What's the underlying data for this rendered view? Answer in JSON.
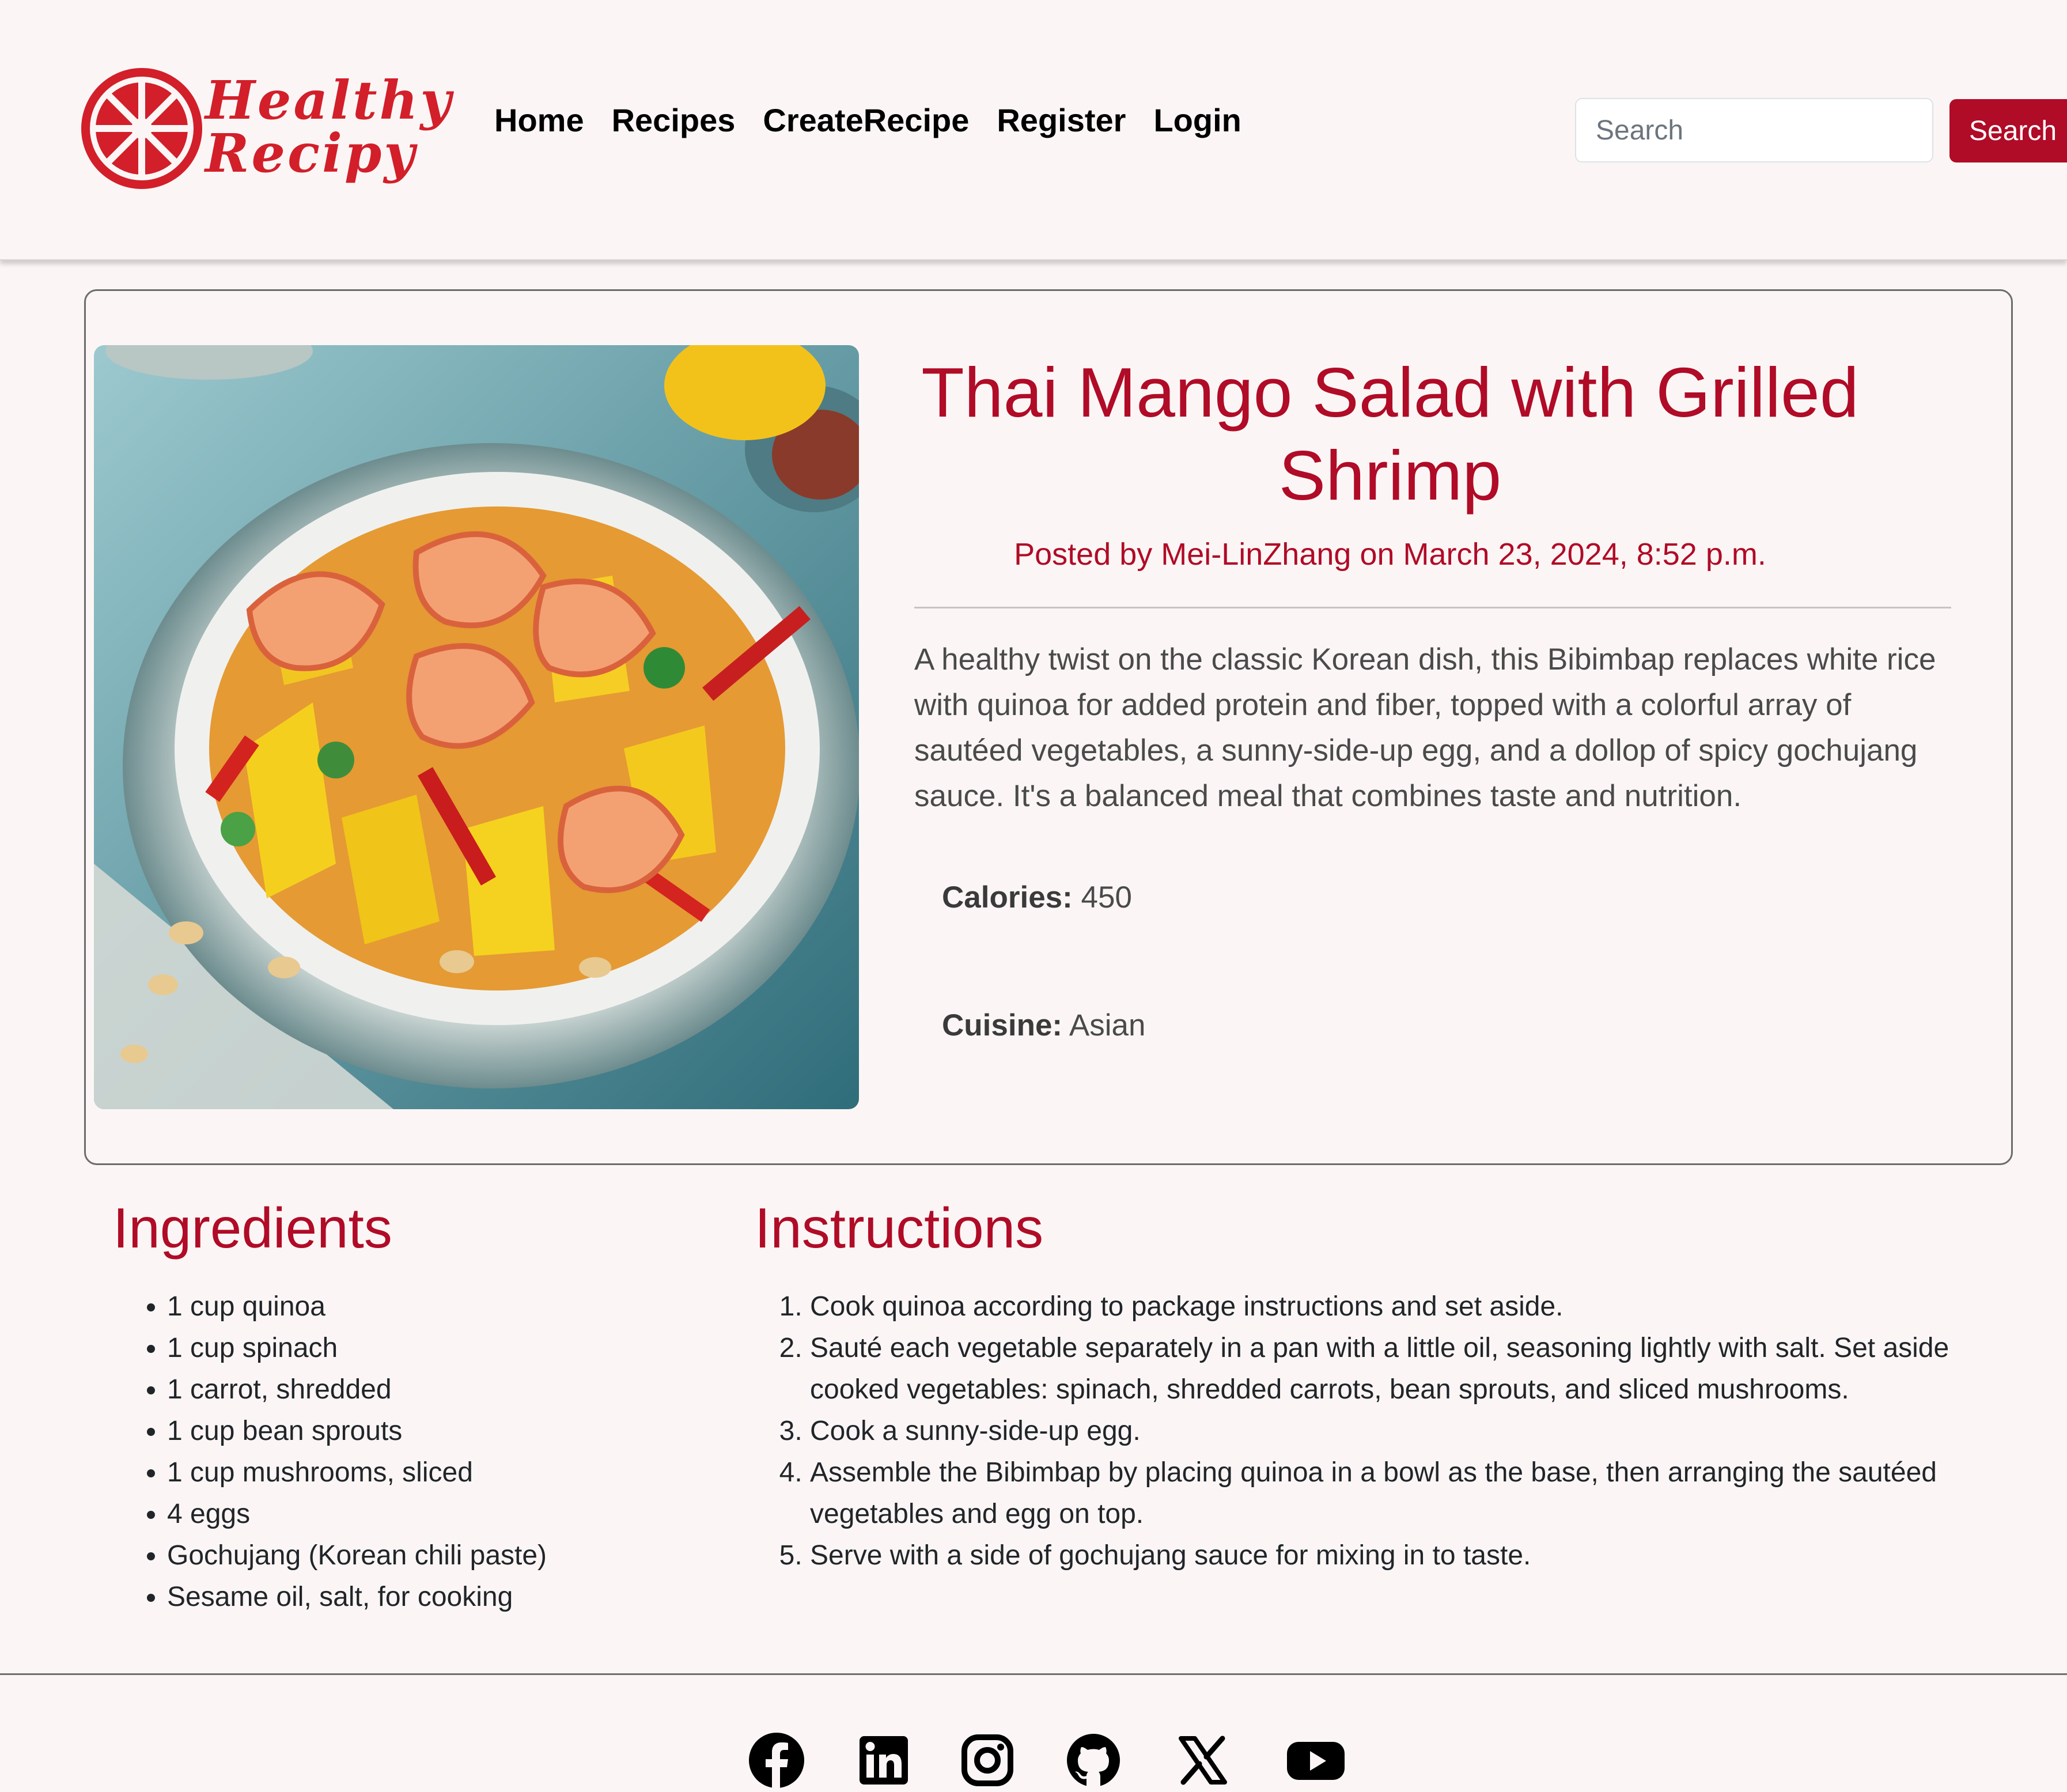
{
  "brand": {
    "line1": "Healthy",
    "line2": "Recipy",
    "accent_color": "#b00b27",
    "logo_color": "#d21f2a"
  },
  "nav": {
    "links": [
      "Home",
      "Recipes",
      "CreateRecipe",
      "Register",
      "Login"
    ]
  },
  "search": {
    "placeholder": "Search",
    "value": "",
    "button_label": "Search"
  },
  "recipe": {
    "title": "Thai Mango Salad with Grilled Shrimp",
    "posted_by": "Posted by Mei-LinZhang on March 23, 2024, 8:52 p.m.",
    "description": "A healthy twist on the classic Korean dish, this Bibimbap replaces white rice with quinoa for added protein and fiber, topped with a colorful array of sautéed vegetables, a sunny-side-up egg, and a dollop of spicy gochujang sauce. It's a balanced meal that combines taste and nutrition.",
    "calories_label": "Calories:",
    "calories_value": "450",
    "cuisine_label": "Cuisine:",
    "cuisine_value": "Asian"
  },
  "ingredients": {
    "heading": "Ingredients",
    "items": [
      "1 cup quinoa",
      "1 cup spinach",
      "1 carrot, shredded",
      "1 cup bean sprouts",
      "1 cup mushrooms, sliced",
      "4 eggs",
      "Gochujang (Korean chili paste)",
      "Sesame oil, salt, for cooking"
    ]
  },
  "instructions": {
    "heading": "Instructions",
    "steps": [
      "Cook quinoa according to package instructions and set aside.",
      "Sauté each vegetable separately in a pan with a little oil, seasoning lightly with salt. Set aside cooked vegetables: spinach, shredded carrots, bean sprouts, and sliced mushrooms.",
      "Cook a sunny-side-up egg.",
      "Assemble the Bibimbap by placing quinoa in a bowl as the base, then arranging the sautéed vegetables and egg on top.",
      "Serve with a side of gochujang sauce for mixing in to taste."
    ]
  },
  "footer": {
    "icons": [
      "facebook-icon",
      "linkedin-icon",
      "instagram-icon",
      "github-icon",
      "x-icon",
      "youtube-icon"
    ]
  }
}
